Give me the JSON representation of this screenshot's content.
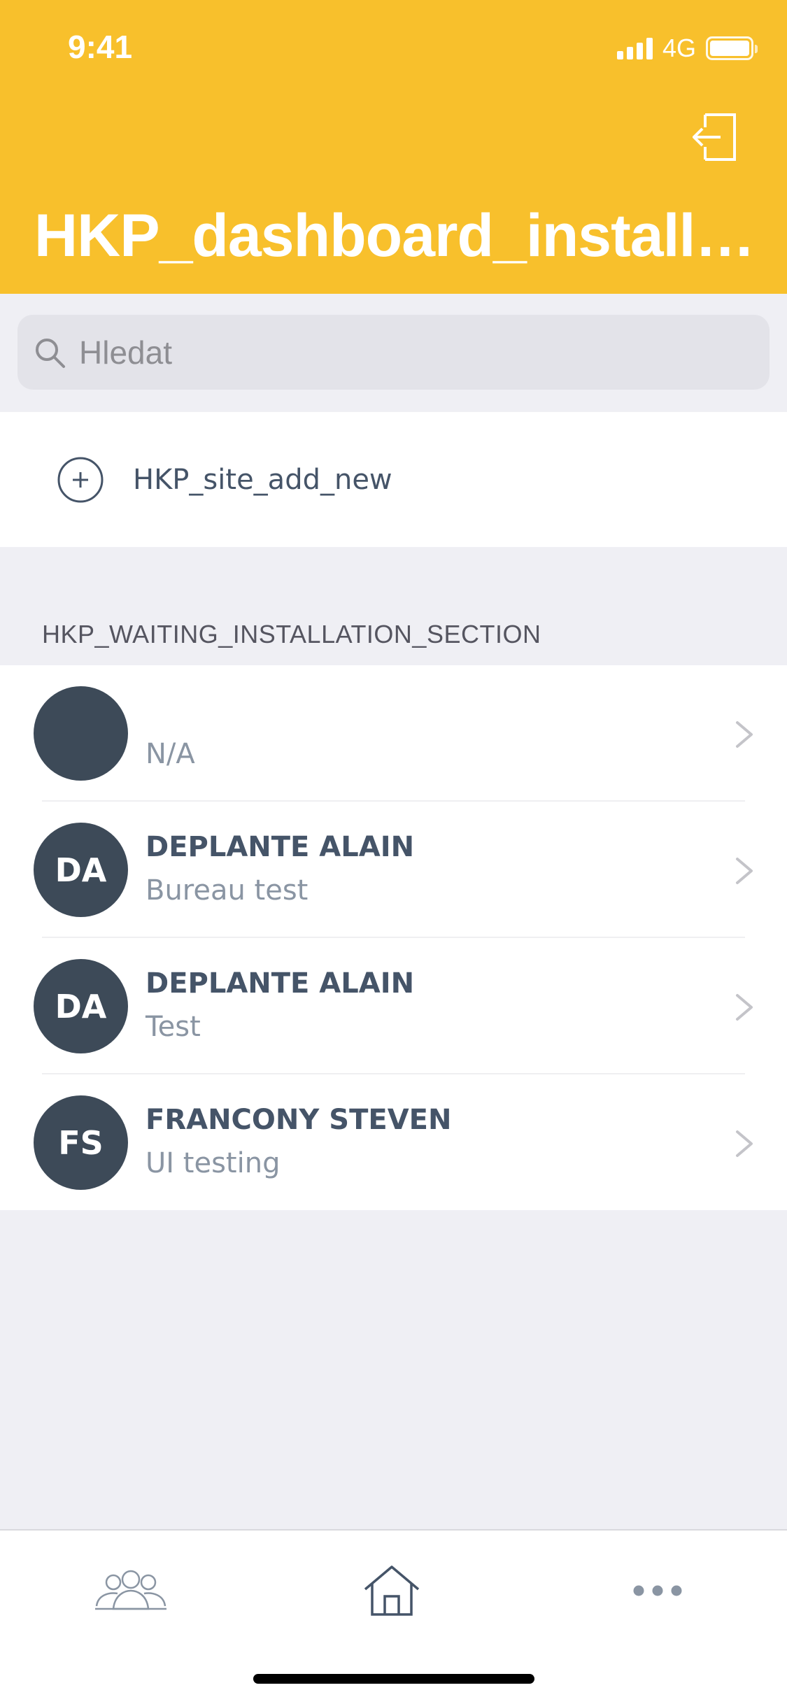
{
  "status_bar": {
    "time": "9:41",
    "network": "4G"
  },
  "header": {
    "title": "HKP_dashboard_installa…"
  },
  "search": {
    "placeholder": "Hledat"
  },
  "add_new": {
    "label": "HKP_site_add_new"
  },
  "section": {
    "title": "HKP_WAITING_INSTALLATION_SECTION"
  },
  "list": [
    {
      "initials": "",
      "name": "",
      "subtitle": "N/A"
    },
    {
      "initials": "DA",
      "name": "DEPLANTE ALAIN",
      "subtitle": "Bureau test"
    },
    {
      "initials": "DA",
      "name": "DEPLANTE ALAIN",
      "subtitle": "Test"
    },
    {
      "initials": "FS",
      "name": "FRANCONY STEVEN",
      "subtitle": "UI testing"
    }
  ],
  "tabbar": {
    "tabs": [
      {
        "icon": "users-icon"
      },
      {
        "icon": "home-icon"
      },
      {
        "icon": "more-icon"
      }
    ]
  },
  "colors": {
    "header_bg": "#F8C02C",
    "avatar_bg": "#3D4A58",
    "text_primary": "#455468",
    "text_secondary": "#8A95A3",
    "background": "#EFEFF4"
  }
}
